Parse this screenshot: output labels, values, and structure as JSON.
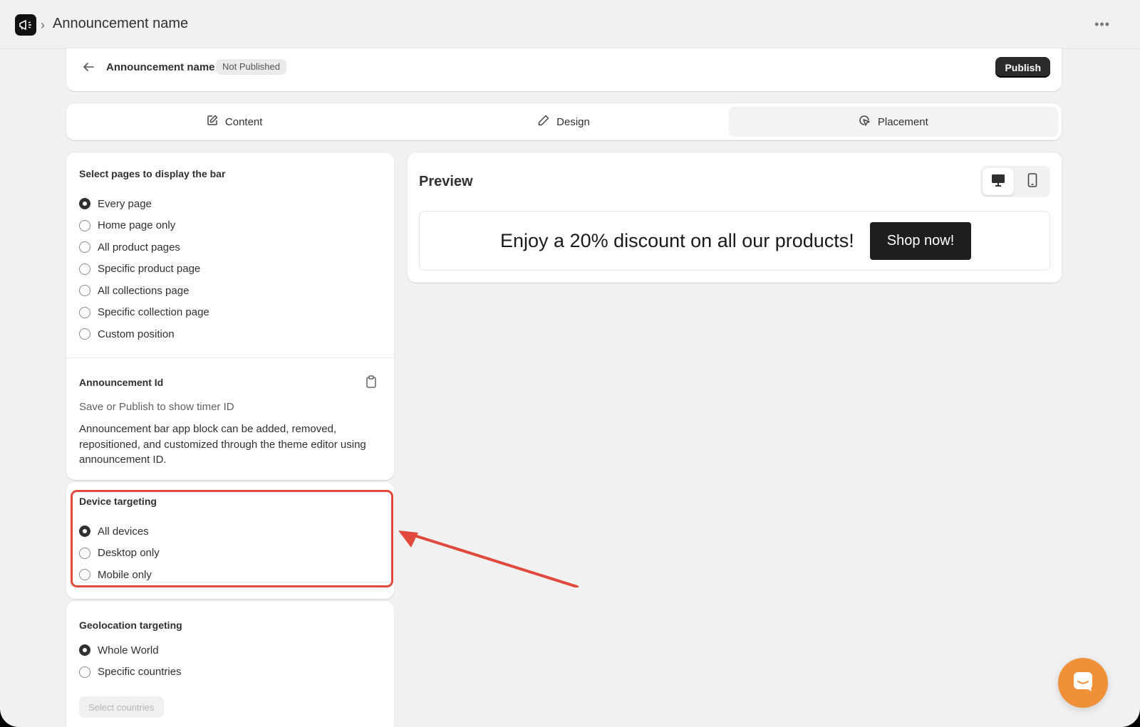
{
  "app": {
    "title": "Announcement name",
    "logo_icon": "megaphone-icon"
  },
  "header": {
    "name": "Announcement name",
    "status": "Not Published",
    "publish_label": "Publish"
  },
  "tabs": [
    {
      "label": "Content",
      "icon": "edit-icon"
    },
    {
      "label": "Design",
      "icon": "pencil-icon"
    },
    {
      "label": "Placement",
      "icon": "cursor-click-icon",
      "active": true
    }
  ],
  "pages": {
    "title": "Select pages to display the bar",
    "options": [
      {
        "label": "Every page",
        "checked": true
      },
      {
        "label": "Home page only"
      },
      {
        "label": "All product pages"
      },
      {
        "label": "Specific product page"
      },
      {
        "label": "All collections page"
      },
      {
        "label": "Specific collection page"
      },
      {
        "label": "Custom position"
      }
    ]
  },
  "announcement_id": {
    "title": "Announcement Id",
    "hint": "Save or Publish to show timer ID",
    "description": "Announcement bar app block can be added, removed, repositioned, and customized through the theme editor using announcement ID."
  },
  "device_targeting": {
    "title": "Device targeting",
    "options": [
      {
        "label": "All devices",
        "checked": true
      },
      {
        "label": "Desktop only"
      },
      {
        "label": "Mobile only"
      }
    ]
  },
  "geo_targeting": {
    "title": "Geolocation targeting",
    "options": [
      {
        "label": "Whole World",
        "checked": true
      },
      {
        "label": "Specific countries"
      }
    ],
    "select_label": "Select countries"
  },
  "preview": {
    "title": "Preview",
    "active_device": "desktop",
    "bar_text": "Enjoy a 20% discount on all our products!",
    "button_label": "Shop now!"
  },
  "colors": {
    "highlight": "#e04a3c",
    "chat": "#f0913a",
    "publish": "#2a2a2a"
  }
}
